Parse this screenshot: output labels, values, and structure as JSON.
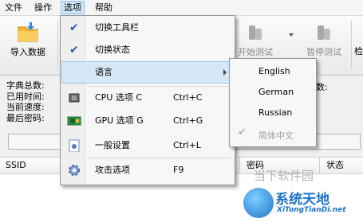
{
  "menubar": [
    "文件",
    "操作",
    "选项",
    "帮助"
  ],
  "toolbar": {
    "import_label": "导入数据",
    "start_label": "开始测试",
    "pause_label": "暂停测试",
    "check_label": "检"
  },
  "info": {
    "dict_total": "字典总数:",
    "elapsed": "已用时间:",
    "speed": "当前速度:",
    "last_password": "最后密码:",
    "right_colon": "数:"
  },
  "table": {
    "col_ssid": "SSID",
    "col_password": "密码",
    "col_status": "状态"
  },
  "options_menu": {
    "toggle_toolbar": "切换工具栏",
    "toggle_status": "切换状态",
    "language": "语言",
    "cpu_label": "CPU 选项 C",
    "cpu_key": "Ctrl+C",
    "gpu_label": "GPU 选项 G",
    "gpu_key": "Ctrl+G",
    "general_label": "一般设置",
    "general_key": "Ctrl+L",
    "attack_label": "攻击选项",
    "attack_key": "F9"
  },
  "language_menu": {
    "english": "English",
    "german": "German",
    "russian": "Russian",
    "chinese": "简体中文"
  },
  "watermark": {
    "top_text": "当下软件园",
    "brand_text": "系统天地",
    "url_text": "XiTongTianDi.net"
  },
  "colors": {
    "highlight": "#d5e8f8",
    "check": "#2a5db0",
    "brand_blue": "#1e73c8"
  }
}
